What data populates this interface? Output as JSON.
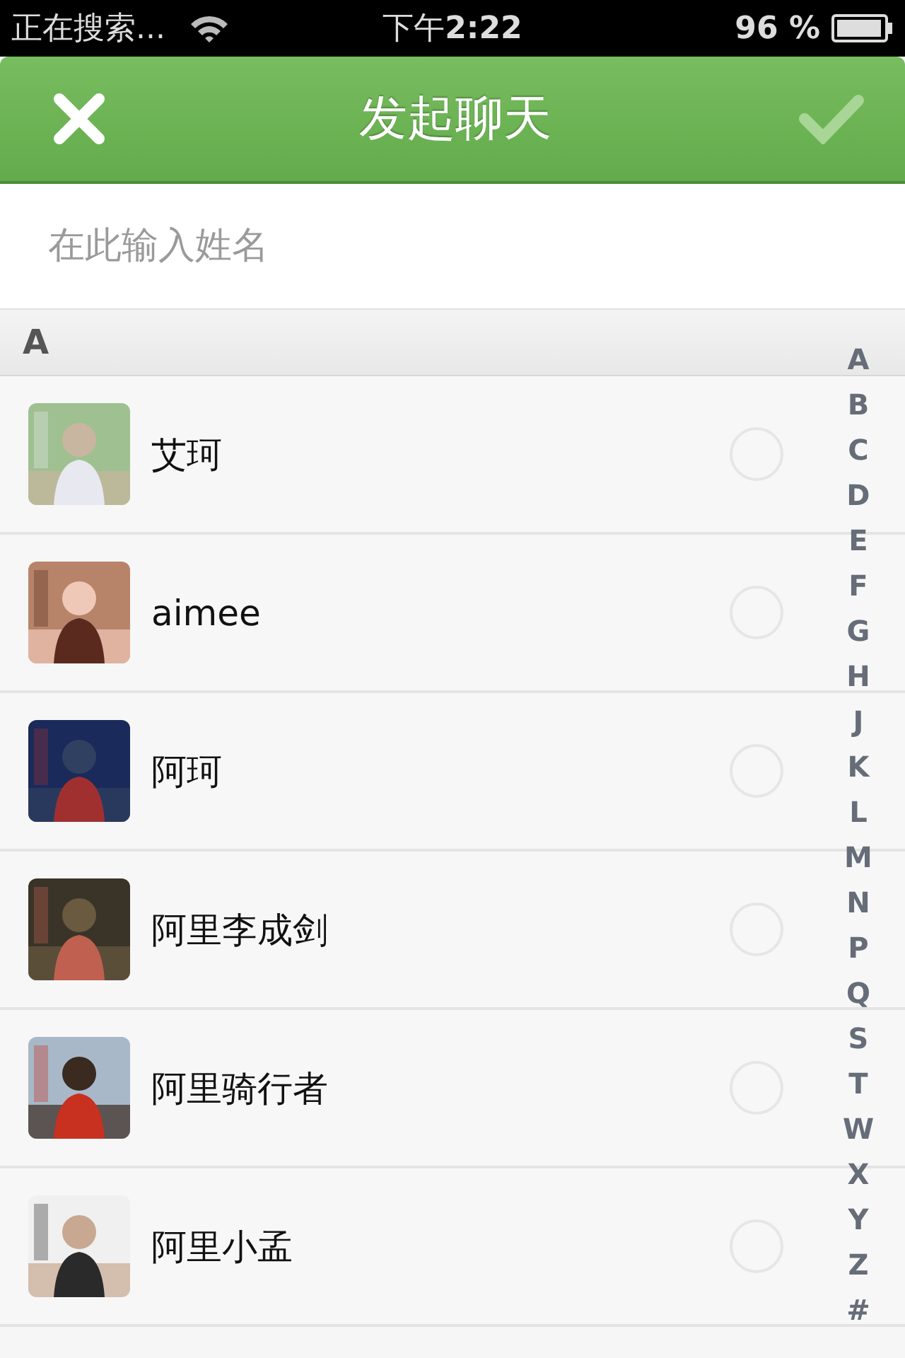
{
  "status_bar": {
    "carrier": "正在搜索...",
    "time_prefix": "下午",
    "time": "2:22",
    "battery": "96 %"
  },
  "header": {
    "title": "发起聊天",
    "confirm_disabled": true
  },
  "search": {
    "placeholder": "在此输入姓名"
  },
  "section": {
    "letter": "A"
  },
  "contacts": [
    {
      "name": "艾珂",
      "selected": false
    },
    {
      "name": "aimee",
      "selected": false
    },
    {
      "name": "阿珂",
      "selected": false
    },
    {
      "name": "阿里李成剑",
      "selected": false
    },
    {
      "name": "阿里骑行者",
      "selected": false
    },
    {
      "name": "阿里小孟",
      "selected": false
    }
  ],
  "index": [
    "A",
    "B",
    "C",
    "D",
    "E",
    "F",
    "G",
    "H",
    "J",
    "K",
    "L",
    "M",
    "N",
    "P",
    "Q",
    "S",
    "T",
    "W",
    "X",
    "Y",
    "Z",
    "#"
  ]
}
